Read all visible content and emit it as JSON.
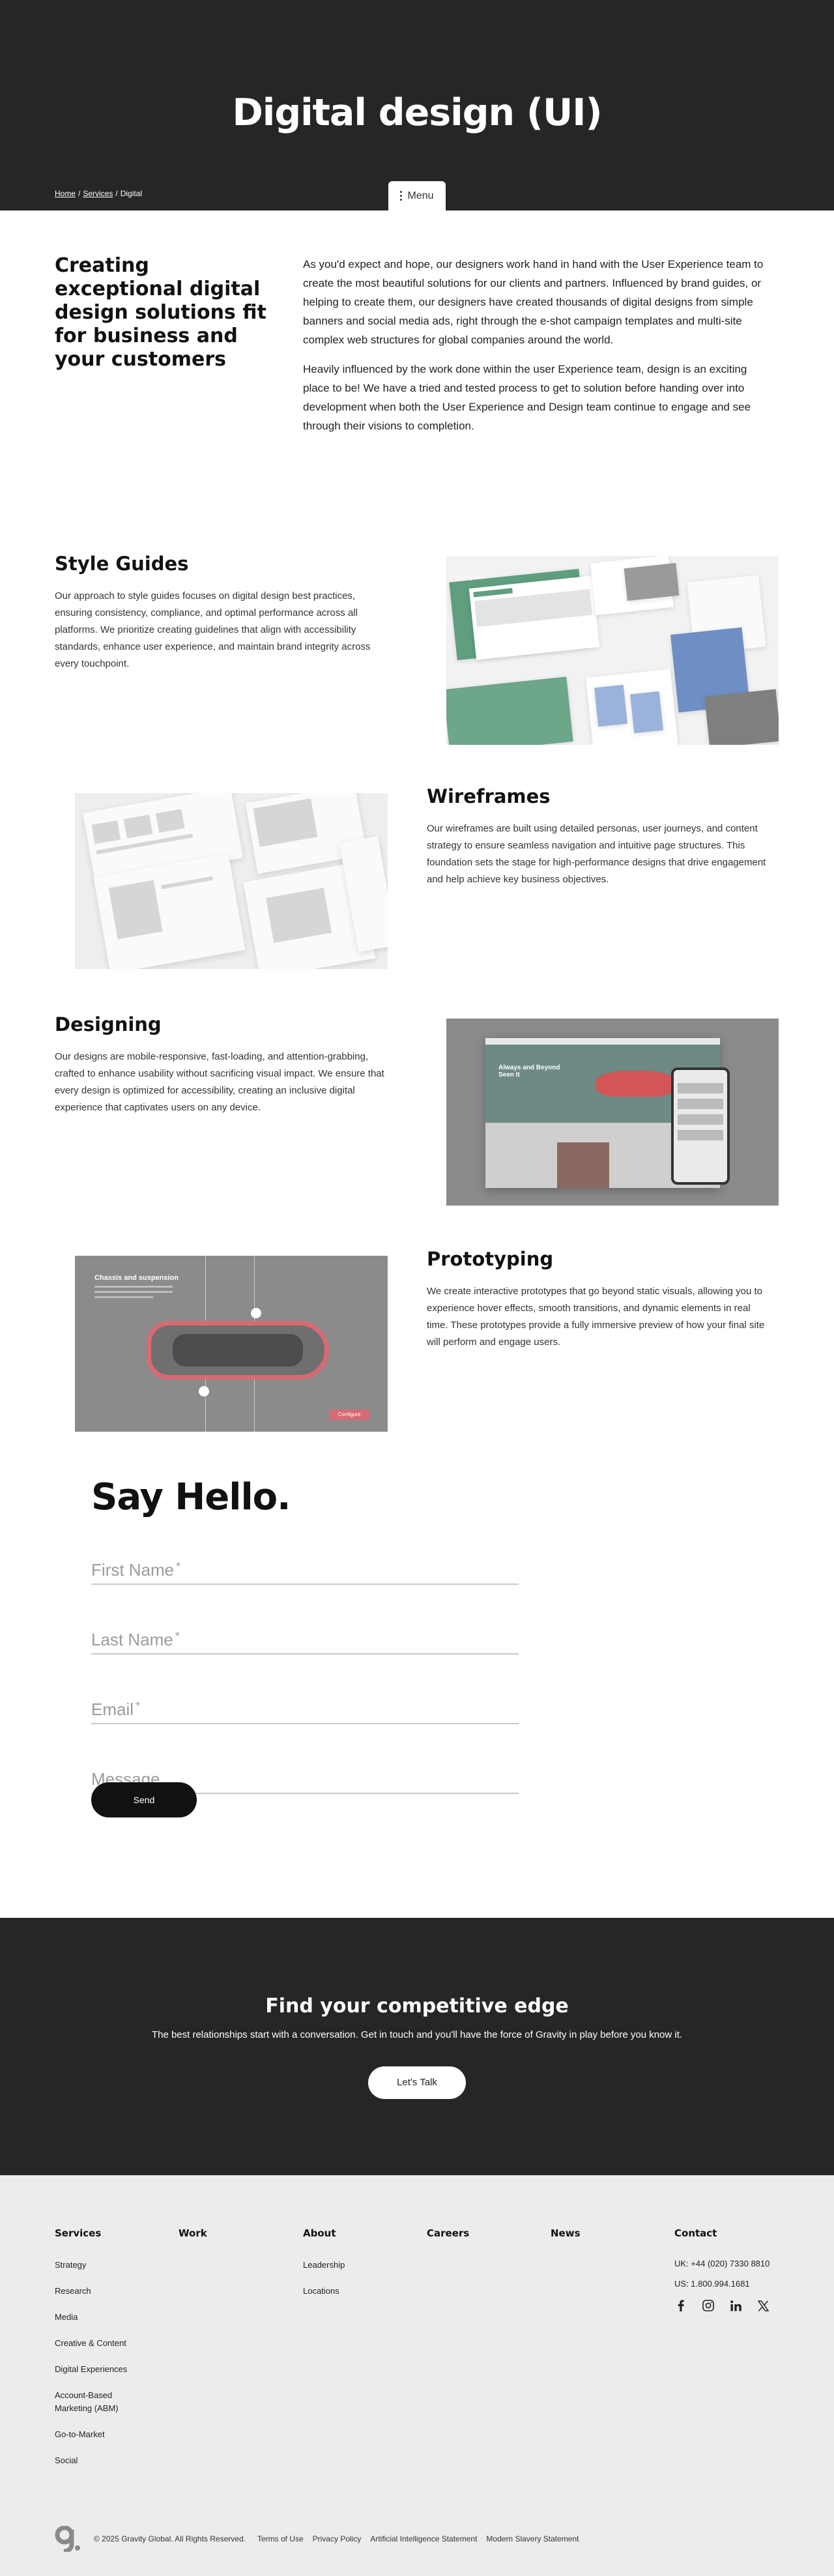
{
  "hero": {
    "title": "Digital design (UI)",
    "breadcrumb": {
      "home": "Home",
      "services": "Services",
      "current": "Digital"
    },
    "menu_label": "Menu"
  },
  "intro": {
    "heading": "Creating exceptional digital design solutions fit for business and your customers",
    "para1": "As you'd expect and hope, our designers work hand in hand with the User Experience team to create the most beautiful solutions for our clients and partners. Influenced by brand guides, or helping to create them, our designers have created thousands of digital designs from simple banners and social media ads, right through the e-shot campaign templates and multi-site complex web structures for global companies around the world.",
    "para2": "Heavily influenced by the work done within the user Experience team, design is an exciting place to be! We have a tried and tested process to get to solution before handing over into development when both the User Experience and Design team continue to engage and see through their visions to completion."
  },
  "features": [
    {
      "title": "Style Guides",
      "body": "Our approach to style guides focuses on digital design best practices, ensuring consistency, compliance, and optimal performance across all platforms. We prioritize creating guidelines that align with accessibility standards, enhance user experience, and maintain brand integrity across every touchpoint."
    },
    {
      "title": "Wireframes",
      "body": "Our wireframes are built using detailed personas, user journeys, and content strategy to ensure seamless navigation and intuitive page structures. This foundation sets the stage for high-performance designs that drive engagement and help achieve key business objectives."
    },
    {
      "title": "Designing",
      "body": "Our designs are mobile-responsive, fast-loading, and attention-grabbing, crafted to enhance usability without sacrificing visual impact. We ensure that every design is optimized for accessibility, creating an inclusive digital experience that captivates users on any device."
    },
    {
      "title": "Prototyping",
      "body": "We create interactive prototypes that go beyond static visuals, allowing you to experience hover effects, smooth transitions, and dynamic elements in real time. These prototypes provide a fully immersive preview of how your final site will perform and engage users."
    }
  ],
  "images": {
    "style_guide_header": "Ecosystem",
    "design_headline": "Always and Beyond Seen It",
    "proto_title": "Chassis and suspension",
    "proto_cta": "Configure"
  },
  "contact": {
    "heading": "Say Hello.",
    "first_name": "First Name",
    "last_name": "Last Name",
    "email": "Email",
    "message": "Message",
    "required_mark": "*",
    "submit_label": "Send"
  },
  "cta": {
    "heading": "Find your competitive edge",
    "text": "The best relationships start with a conversation. Get in touch and you'll have the force of Gravity in play before you know it.",
    "button": "Let's Talk"
  },
  "footer": {
    "services": {
      "title": "Services",
      "links": [
        "Strategy",
        "Research",
        "Media",
        "Creative & Content",
        "Digital Experiences",
        "Account-Based Marketing (ABM)",
        "Go-to-Market",
        "Social"
      ]
    },
    "work": {
      "title": "Work"
    },
    "about": {
      "title": "About",
      "links": [
        "Leadership",
        "Locations"
      ]
    },
    "careers": {
      "title": "Careers"
    },
    "news": {
      "title": "News"
    },
    "contact": {
      "title": "Contact",
      "uk": "UK: +44 (020) 7330 8810",
      "us": "US: 1.800.994.1681"
    },
    "social_icons": [
      "facebook-icon",
      "instagram-icon",
      "linkedin-icon",
      "x-icon"
    ],
    "legal": "© 2025 Gravity Global. All Rights Reserved.",
    "links": [
      "Terms of Use",
      "Privacy Policy",
      "Artificial Intelligence Statement",
      "Modern Slavery Statement"
    ]
  }
}
